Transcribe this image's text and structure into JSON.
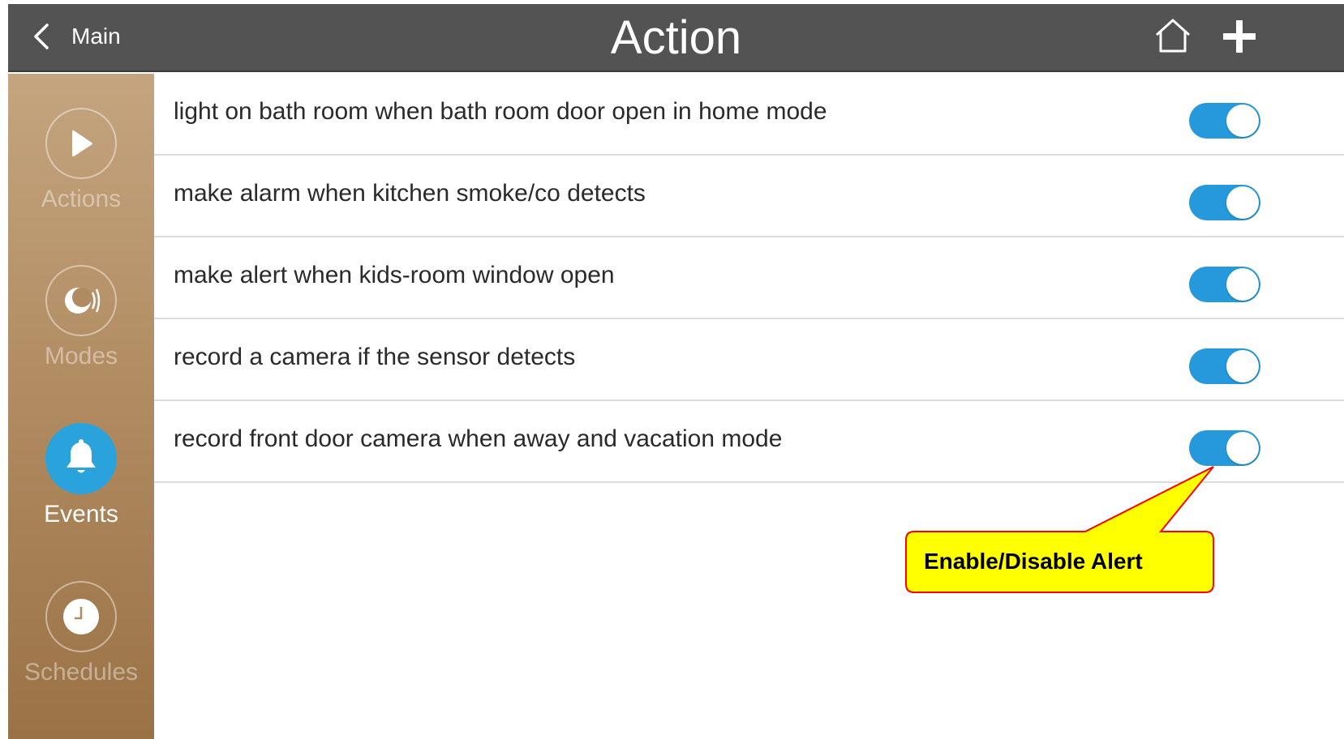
{
  "header": {
    "back_label": "Main",
    "title": "Action"
  },
  "sidebar": {
    "items": [
      {
        "label": "Actions",
        "icon": "play-icon",
        "active": false
      },
      {
        "label": "Modes",
        "icon": "modes-icon",
        "active": false
      },
      {
        "label": "Events",
        "icon": "bell-icon",
        "active": true
      },
      {
        "label": "Schedules",
        "icon": "clock-icon",
        "active": false
      }
    ]
  },
  "rules": [
    {
      "label": "light on bath room when bath room door open in home mode",
      "enabled": true
    },
    {
      "label": "make alarm when kitchen smoke/co detects",
      "enabled": true
    },
    {
      "label": "make alert when kids-room window open",
      "enabled": true
    },
    {
      "label": "record a camera if the sensor detects",
      "enabled": true
    },
    {
      "label": "record front door camera when away and vacation mode",
      "enabled": true
    }
  ],
  "callout": {
    "text": "Enable/Disable Alert"
  },
  "colors": {
    "header": "#535353",
    "accent": "#2599dc",
    "sidebar_top": "#c4a57f",
    "sidebar_bottom": "#9a7246",
    "callout_fill": "#ffff00",
    "callout_border": "#ff0000"
  }
}
